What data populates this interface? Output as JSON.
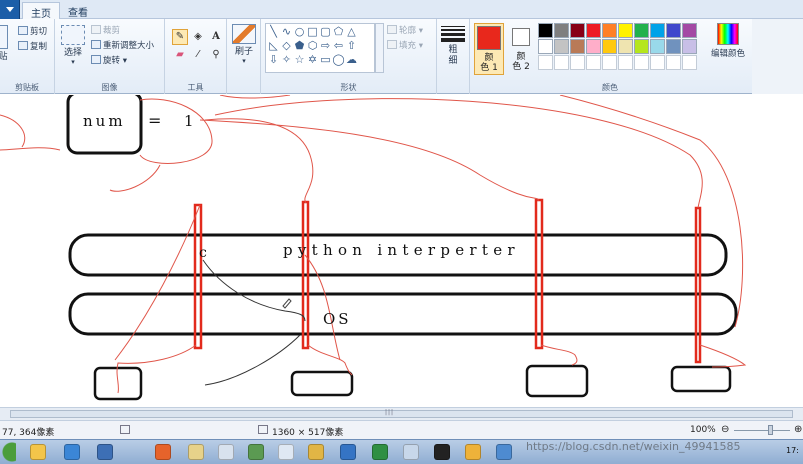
{
  "ribbon_tabs": {
    "home": "主页",
    "view": "查看"
  },
  "clipboard": {
    "cut": "剪切",
    "copy": "复制",
    "paste_fragment": "贴",
    "group_label": "剪贴板"
  },
  "image": {
    "select": "选择",
    "crop": "裁剪",
    "resize": "重新调整大小",
    "rotate": "旋转",
    "group_label": "图像"
  },
  "tools": {
    "group_label": "工具",
    "text_tool_glyph": "A"
  },
  "brushes": {
    "label": "刷子"
  },
  "shapes": {
    "outline": "轮廓",
    "fill": "填充",
    "group_label": "形状"
  },
  "size": {
    "label_top": "粗",
    "label_bottom": "细"
  },
  "colors": {
    "color1_label_top": "颜",
    "color1_label_bottom": "色 1",
    "color2_label_top": "颜",
    "color2_label_bottom": "色 2",
    "color1_value": "#e8281c",
    "color2_value": "#ffffff",
    "palette_row1": [
      "#000000",
      "#7f7f7f",
      "#880015",
      "#ed1c24",
      "#ff7f27",
      "#fff200",
      "#22b14c",
      "#00a2e8",
      "#3f48cc",
      "#a349a4"
    ],
    "palette_row2": [
      "#ffffff",
      "#c3c3c3",
      "#b97a57",
      "#ffaec9",
      "#ffc90e",
      "#efe4b0",
      "#b5e61d",
      "#99d9ea",
      "#7092be",
      "#c8bfe7"
    ],
    "edit_colors": "编辑颜色",
    "group_label": "颜色"
  },
  "canvas": {
    "num_label": "num",
    "equals": "=",
    "value": "1",
    "interpreter_text": "python interperter",
    "os_text": "OS",
    "c_label": "c"
  },
  "status": {
    "cursor": "77, 364像素",
    "image_size": "1360 × 517像素",
    "zoom": "100%"
  },
  "taskbar": {
    "watermark": "https://blog.csdn.net/weixin_49941585",
    "clock": "17:"
  }
}
